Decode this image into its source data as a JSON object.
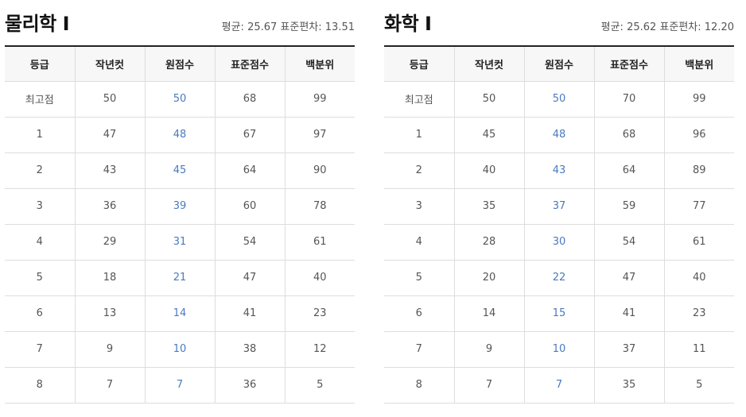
{
  "columns": [
    "등급",
    "작년컷",
    "원점수",
    "표준점수",
    "백분위"
  ],
  "panels": [
    {
      "title": "물리학 Ⅰ",
      "stats": "평균: 25.67 표준편차: 13.51",
      "rows": [
        [
          "최고점",
          "50",
          "50",
          "68",
          "99"
        ],
        [
          "1",
          "47",
          "48",
          "67",
          "97"
        ],
        [
          "2",
          "43",
          "45",
          "64",
          "90"
        ],
        [
          "3",
          "36",
          "39",
          "60",
          "78"
        ],
        [
          "4",
          "29",
          "31",
          "54",
          "61"
        ],
        [
          "5",
          "18",
          "21",
          "47",
          "40"
        ],
        [
          "6",
          "13",
          "14",
          "41",
          "23"
        ],
        [
          "7",
          "9",
          "10",
          "38",
          "12"
        ],
        [
          "8",
          "7",
          "7",
          "36",
          "5"
        ]
      ]
    },
    {
      "title": "화학 Ⅰ",
      "stats": "평균: 25.62 표준편차: 12.20",
      "rows": [
        [
          "최고점",
          "50",
          "50",
          "70",
          "99"
        ],
        [
          "1",
          "45",
          "48",
          "68",
          "96"
        ],
        [
          "2",
          "40",
          "43",
          "64",
          "89"
        ],
        [
          "3",
          "35",
          "37",
          "59",
          "77"
        ],
        [
          "4",
          "28",
          "30",
          "54",
          "61"
        ],
        [
          "5",
          "20",
          "22",
          "47",
          "40"
        ],
        [
          "6",
          "14",
          "15",
          "41",
          "23"
        ],
        [
          "7",
          "9",
          "10",
          "37",
          "11"
        ],
        [
          "8",
          "7",
          "7",
          "35",
          "5"
        ]
      ]
    }
  ],
  "colors": {
    "raw_score": "#4a7abf",
    "header_bg": "#f7f7f7",
    "border": "#dddddd"
  }
}
